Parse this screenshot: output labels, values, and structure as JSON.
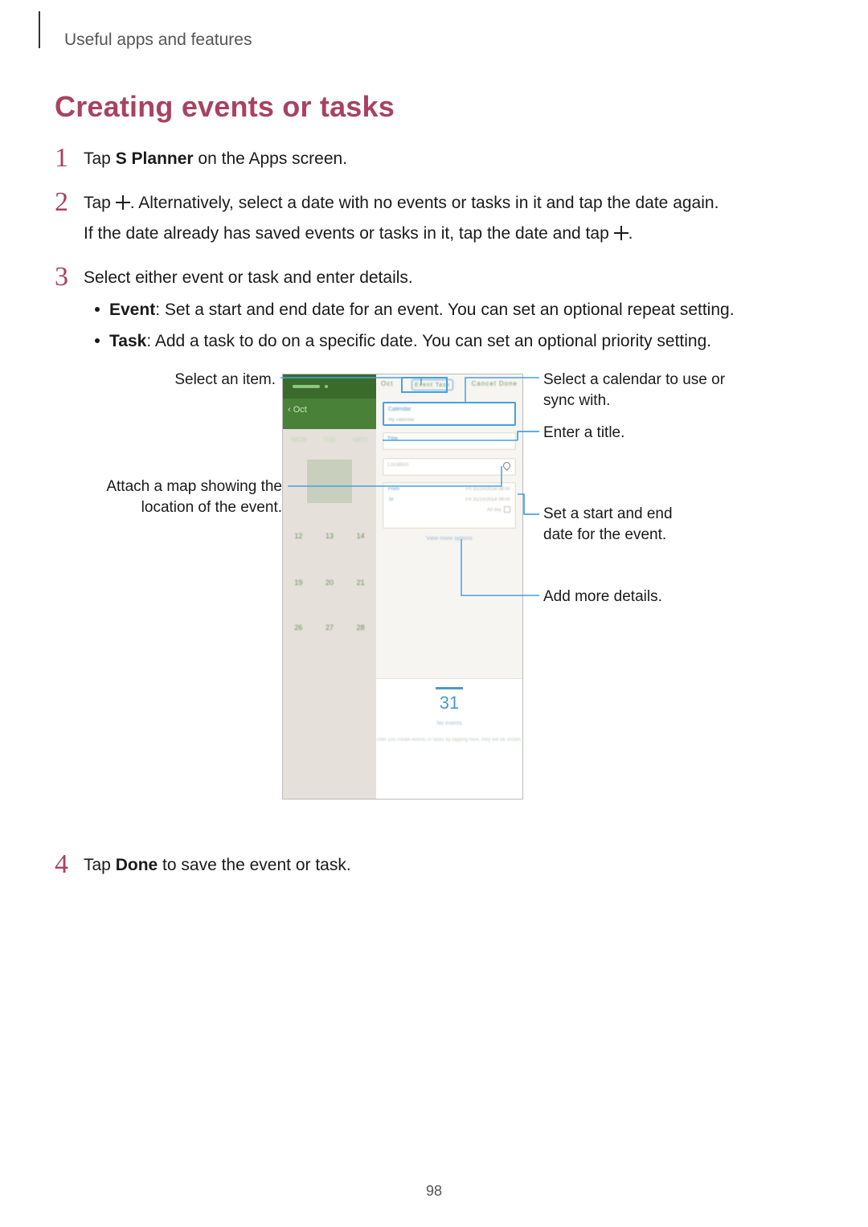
{
  "chapter": "Useful apps and features",
  "section_title": "Creating events or tasks",
  "steps": {
    "s1_num": "1",
    "s1_pre": "Tap ",
    "s1_bold": "S Planner",
    "s1_post": " on the Apps screen.",
    "s2_num": "2",
    "s2_l1_pre": "Tap ",
    "s2_l1_post": ". Alternatively, select a date with no events or tasks in it and tap the date again.",
    "s2_l2_pre": "If the date already has saved events or tasks in it, tap the date and tap ",
    "s2_l2_post": ".",
    "s3_num": "3",
    "s3_line": "Select either event or task and enter details.",
    "s3_b1_bold": "Event",
    "s3_b1_rest": ": Set a start and end date for an event. You can set an optional repeat setting.",
    "s3_b2_bold": "Task",
    "s3_b2_rest": ": Add a task to do on a specific date. You can set an optional priority setting.",
    "s4_num": "4",
    "s4_pre": "Tap ",
    "s4_bold": "Done",
    "s4_post": " to save the event or task."
  },
  "callouts": {
    "select_item": "Select an item.",
    "attach_map": "Attach a map showing the location of the event.",
    "select_calendar": "Select a calendar to use or sync with.",
    "enter_title": "Enter a title.",
    "set_date": "Set a start and end date for the event.",
    "more": "Add more details."
  },
  "phone": {
    "month": "Oct",
    "back": "‹ Oct",
    "dow": [
      "MON",
      "TUE",
      "WED"
    ],
    "row2": [
      "12",
      "13",
      "14"
    ],
    "row3": [
      "19",
      "20",
      "21"
    ],
    "row4": [
      "26",
      "27",
      "28"
    ],
    "tab_event_task": "Event   Task",
    "tab_cancel_done": "Cancel   Done",
    "calendar_label": "Calendar",
    "calendar_sub": "My calendar",
    "title_label": "Title",
    "location_label": "Location",
    "from_label": "From",
    "to_label": "To",
    "from_val": "Fri 31/10/2014  08:00",
    "to_val": "Fri 31/10/2014  09:00",
    "all_day": "All day",
    "view_more": "View more options",
    "big_date": "31",
    "no_events": "No events",
    "tip": "After you create events or tasks by tapping here, they will be shown."
  },
  "page_number": "98"
}
